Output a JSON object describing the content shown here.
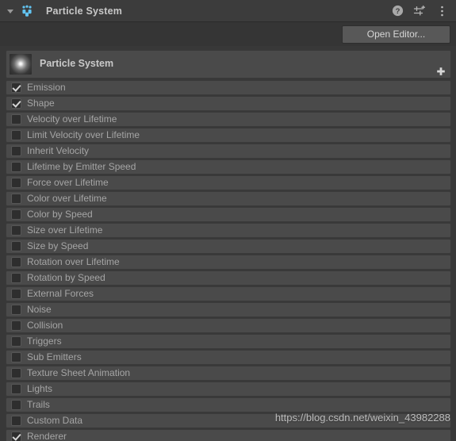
{
  "window": {
    "component_title": "Particle System",
    "component_icon": "particle-system-icon",
    "foldout_icon": "triangle-down-icon",
    "actions": [
      {
        "name": "help-icon",
        "glyph": "?"
      },
      {
        "name": "preset-icon",
        "glyph": "preset"
      },
      {
        "name": "more-menu-icon",
        "glyph": "kebab"
      }
    ]
  },
  "toolbar": {
    "open_editor_label": "Open Editor..."
  },
  "main_module": {
    "label": "Particle System",
    "thumbnail": "particle-preview-thumbnail",
    "add_button": "plus-icon"
  },
  "modules": [
    {
      "label": "Emission",
      "checked": true
    },
    {
      "label": "Shape",
      "checked": true
    },
    {
      "label": "Velocity over Lifetime",
      "checked": false
    },
    {
      "label": "Limit Velocity over Lifetime",
      "checked": false
    },
    {
      "label": "Inherit Velocity",
      "checked": false
    },
    {
      "label": "Lifetime by Emitter Speed",
      "checked": false
    },
    {
      "label": "Force over Lifetime",
      "checked": false
    },
    {
      "label": "Color over Lifetime",
      "checked": false
    },
    {
      "label": "Color by Speed",
      "checked": false
    },
    {
      "label": "Size over Lifetime",
      "checked": false
    },
    {
      "label": "Size by Speed",
      "checked": false
    },
    {
      "label": "Rotation over Lifetime",
      "checked": false
    },
    {
      "label": "Rotation by Speed",
      "checked": false
    },
    {
      "label": "External Forces",
      "checked": false
    },
    {
      "label": "Noise",
      "checked": false
    },
    {
      "label": "Collision",
      "checked": false
    },
    {
      "label": "Triggers",
      "checked": false
    },
    {
      "label": "Sub Emitters",
      "checked": false
    },
    {
      "label": "Texture Sheet Animation",
      "checked": false
    },
    {
      "label": "Lights",
      "checked": false
    },
    {
      "label": "Trails",
      "checked": false
    },
    {
      "label": "Custom Data",
      "checked": false
    },
    {
      "label": "Renderer",
      "checked": true
    }
  ],
  "watermark": {
    "text": "https://blog.csdn.net/weixin_43982288"
  },
  "colors": {
    "titlebar_bg": "#3c3c3c",
    "toolbar_bg": "#353535",
    "panel_bg": "#383838",
    "row_bg": "#4a4a4a",
    "row_border": "#3a3a3a",
    "label_text": "#a5a5a5",
    "title_text": "#c8c8c8",
    "accent_icon": "#5ec0f0",
    "button_bg": "#585858"
  }
}
